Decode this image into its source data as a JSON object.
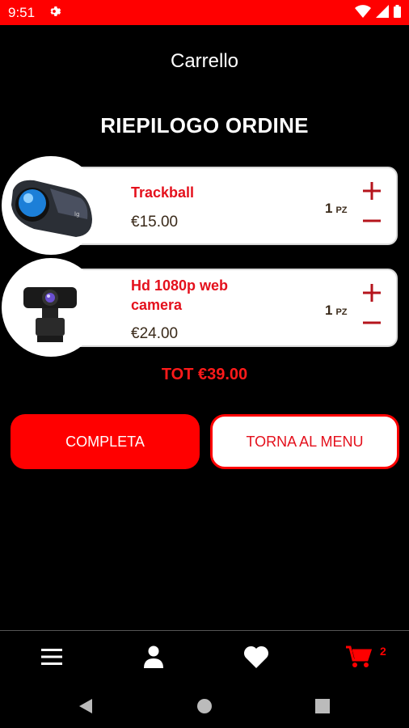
{
  "status_bar": {
    "time": "9:51"
  },
  "app_bar": {
    "title": "Carrello"
  },
  "page": {
    "title": "RIEPILOGO ORDINE"
  },
  "cart": {
    "items": [
      {
        "name": "Trackball",
        "price": "€15.00",
        "quantity": "1",
        "unit": "PZ",
        "image": "trackball-mouse-image"
      },
      {
        "name": "Hd 1080p web camera",
        "price": "€24.00",
        "quantity": "1",
        "unit": "PZ",
        "image": "webcam-image"
      }
    ],
    "total": "TOT €39.00"
  },
  "actions": {
    "complete_label": "COMPLETA",
    "back_label": "TORNA AL MENU"
  },
  "bottom_nav": {
    "items": [
      "menu-icon",
      "user-icon",
      "heart-icon",
      "cart-icon"
    ],
    "cart_badge": "2"
  },
  "colors": {
    "accent": "#ff0000",
    "product_name": "#e4101c",
    "background": "#000000"
  }
}
